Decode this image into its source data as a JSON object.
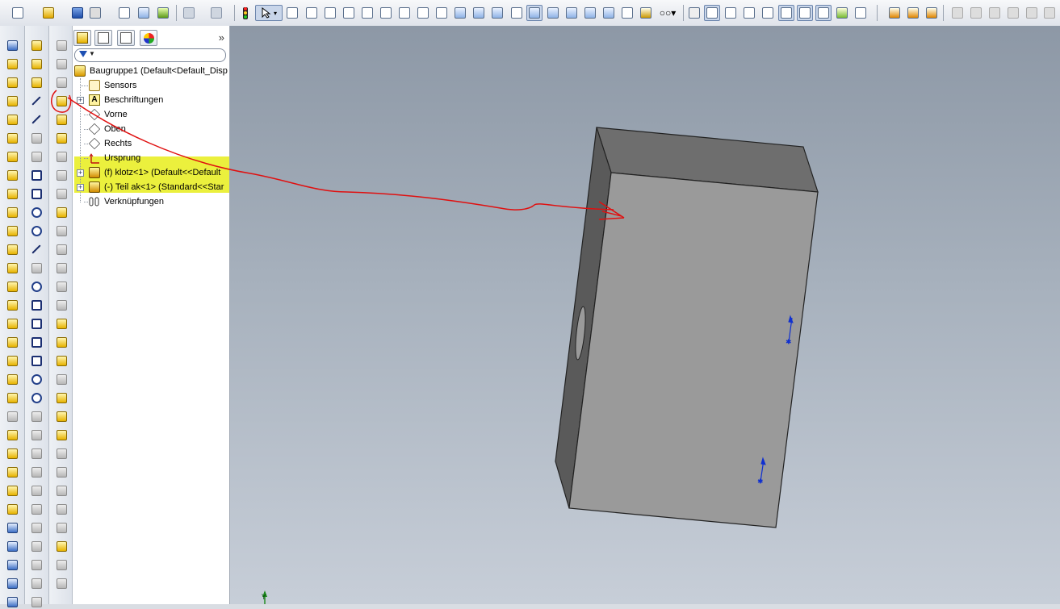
{
  "toolbar": {
    "icons": [
      "new-document-icon",
      "open-icon",
      "save-icon",
      "print-icon",
      "print-preview-icon",
      "options-icon",
      "rebuild-icon",
      "undo-icon",
      "redo-icon",
      "traffic-light-icon",
      "select-icon",
      "view-orientation-icon",
      "zoom-icon",
      "shaded-icon",
      "display-style-icon",
      "rotate-icon",
      "section-view-icon",
      "hide-show-icon",
      "mate-icon",
      "move-component-icon"
    ]
  },
  "tree": {
    "root": "Baugruppe1  (Default<Default_Disp",
    "items": [
      {
        "label": "Sensors",
        "icon": "sensors-icon"
      },
      {
        "label": "Beschriftungen",
        "icon": "annotations-icon"
      },
      {
        "label": "Vorne",
        "icon": "plane-icon"
      },
      {
        "label": "Oben",
        "icon": "plane-icon"
      },
      {
        "label": "Rechts",
        "icon": "plane-icon"
      },
      {
        "label": "Ursprung",
        "icon": "origin-icon"
      },
      {
        "label": "(f) klotz<1> (Default<<Default",
        "icon": "part-icon"
      },
      {
        "label": "(-) Teil ak<1> (Standard<<Star",
        "icon": "part-icon"
      },
      {
        "label": "Verknüpfungen",
        "icon": "mates-icon"
      }
    ]
  },
  "colors": {
    "highlight": "#e9ef2c",
    "annotation": "#e01010",
    "model_face": "#9a9a9a",
    "model_top": "#6e6e6e",
    "model_side": "#5a5a5a"
  },
  "viewport": {
    "axis_label": "Y"
  }
}
